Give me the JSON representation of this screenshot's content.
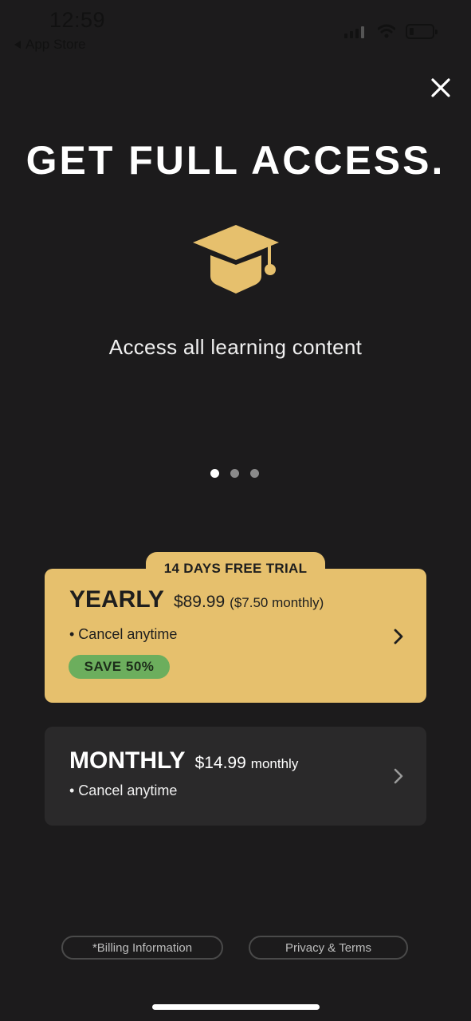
{
  "status_bar": {
    "time": "12:59",
    "back_label": "App Store",
    "icons": [
      "cellular-signal-icon",
      "wifi-icon",
      "battery-icon"
    ]
  },
  "close_icon": "close-icon",
  "headline": "GET FULL ACCESS.",
  "feature": {
    "icon": "graduation-cap-icon",
    "text": "Access all learning content"
  },
  "carousel": {
    "pages": 3,
    "active_index": 0
  },
  "plans": {
    "yearly": {
      "badge_top": "14 DAYS FREE TRIAL",
      "name": "YEARLY",
      "price": "$89.99",
      "sub_price": "($7.50 monthly)",
      "bullet": "• Cancel anytime",
      "save_badge": "SAVE 50%"
    },
    "monthly": {
      "name": "MONTHLY",
      "price": "$14.99",
      "sub_price": "monthly",
      "bullet": "• Cancel anytime"
    }
  },
  "footer": {
    "billing_label": "*Billing Information",
    "privacy_label": "Privacy & Terms"
  },
  "colors": {
    "background": "#1c1b1c",
    "accent_gold": "#e6c06d",
    "save_green": "#6cae5d",
    "monthly_card": "#2a292a"
  }
}
